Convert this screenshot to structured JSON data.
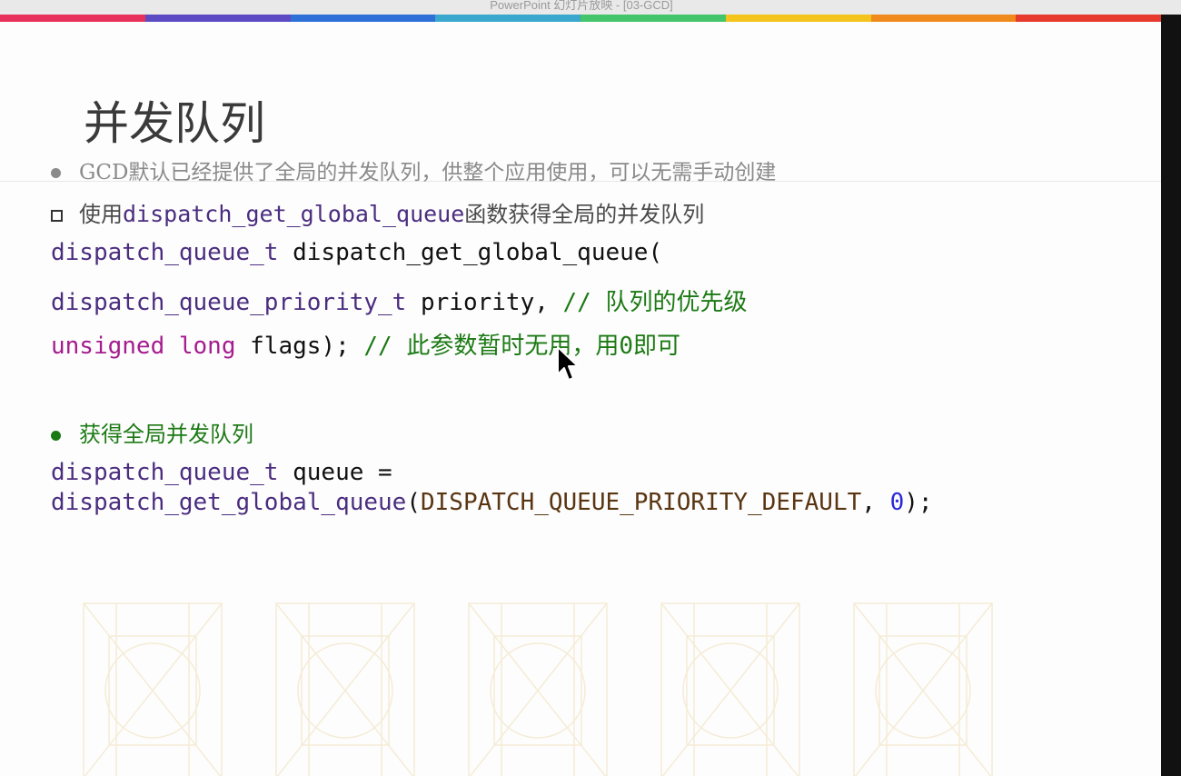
{
  "window": {
    "title": "PowerPoint 幻灯片放映 - [03-GCD]"
  },
  "colors": {
    "accent_bar": [
      "#e8315a",
      "#5d4bc4",
      "#2f6fd8",
      "#3aa7cf",
      "#44c46b",
      "#f4c41c",
      "#f08a1c",
      "#e63a2e"
    ]
  },
  "slide": {
    "title": "并发队列",
    "intro": "GCD默认已经提供了全局的并发队列，供整个应用使用，可以无需手动创建",
    "sub_bullet": {
      "prefix": "使用",
      "func": "dispatch_get_global_queue",
      "suffix": "函数获得全局的并发队列"
    },
    "decl": {
      "line1": {
        "type": "dispatch_queue_t",
        "rest": " dispatch_get_global_queue("
      },
      "line2": {
        "type": "dispatch_queue_priority_t",
        "rest": " priority, ",
        "comment": "// 队列的优先级"
      },
      "line3": {
        "kw": "unsigned long",
        "rest": " flags); ",
        "comment": "// 此参数暂时无用，用0即可"
      }
    },
    "get_bullet": "获得全局并发队列",
    "example": {
      "line1": {
        "type": "dispatch_queue_t",
        "rest": " queue ="
      },
      "line2": {
        "func": "dispatch_get_global_queue",
        "open": "(",
        "const": "DISPATCH_QUEUE_PRIORITY_DEFAULT",
        "sep": ", ",
        "num": "0",
        "close": ");"
      }
    }
  }
}
